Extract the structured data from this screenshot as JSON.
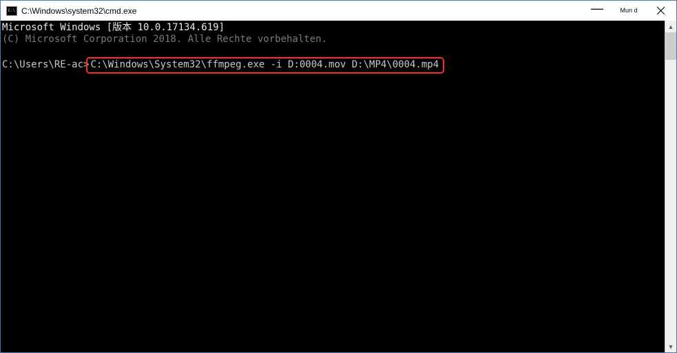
{
  "window": {
    "title": "C:\\Windows\\system32\\cmd.exe",
    "controls": {
      "minimize_glyph": "—",
      "middle_label": "Mun\nd",
      "close_label": "×"
    }
  },
  "console": {
    "line1": "Microsoft Windows [版本 10.0.17134.619]",
    "line2": "(C) Microsoft Corporation 2018. Alle Rechte vorbehalten.",
    "prompt": "C:\\Users\\RE-ac>",
    "command": "C:\\Windows\\System32\\ffmpeg.exe -i D:0004.mov D:\\MP4\\0004.mp4"
  },
  "scrollbar": {
    "up_glyph": "▲",
    "down_glyph": "▼"
  }
}
